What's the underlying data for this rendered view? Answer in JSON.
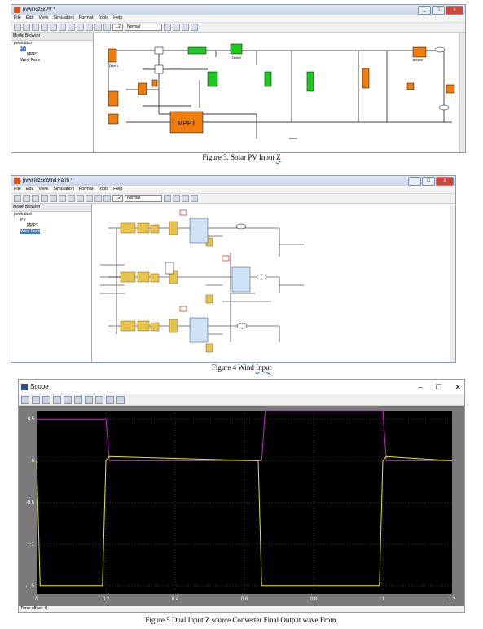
{
  "fig3": {
    "title": "pvwindzsi/PV *",
    "menu": [
      "File",
      "Edit",
      "View",
      "Simulation",
      "Format",
      "Tools",
      "Help"
    ],
    "sim_time": "1.2",
    "sim_mode": "Normal",
    "browser_title": "Model Browser",
    "tree": [
      "pvwindzsi",
      "PV",
      "MPPT",
      "Wind Farm"
    ],
    "mppt_label": "MPPT",
    "block_labels": [
      "Diode1",
      "Diode2",
      "Breaker"
    ],
    "caption": "Figure 3.  Solar PV Input ",
    "caption_z": "Z"
  },
  "fig4": {
    "title": "pvwindzsi/Wind Farm *",
    "menu": [
      "File",
      "Edit",
      "View",
      "Simulation",
      "Format",
      "Tools",
      "Help"
    ],
    "sim_time": "1.2",
    "sim_mode": "Normal",
    "browser_title": "Model Browser",
    "tree": [
      "pvwindzsi",
      "PV",
      "MPPT",
      "Wind Farm"
    ],
    "caption": "Figure 4 Wind ",
    "caption_input": "Input"
  },
  "fig5": {
    "title": "Scope",
    "time_offset_label": "Time offset:",
    "time_offset_value": "0",
    "caption": "Figure 5  Dual Input Z source Converter Final Output wave From."
  },
  "chart_data": {
    "type": "line",
    "title": "",
    "xlim": [
      0,
      1.2
    ],
    "ylim": [
      -1.6,
      0.6
    ],
    "xticks": [
      "0",
      "0.2",
      "0.4",
      "0.6",
      "0.8",
      "1",
      "1.2"
    ],
    "yticks": [
      "0.5",
      "0",
      "-0.5",
      "-1",
      "-1.5"
    ],
    "grid": true,
    "series": [
      {
        "color": "#d020d0",
        "x": [
          0,
          0.2,
          0.21,
          0.65,
          0.66,
          1.0,
          1.01,
          1.2
        ],
        "y": [
          0.5,
          0.5,
          0,
          0,
          0.6,
          0.6,
          0,
          0
        ]
      },
      {
        "color": "#e8e820",
        "x": [
          0,
          0.01,
          0.19,
          0.2,
          0.21,
          0.64,
          0.65,
          0.66,
          0.99,
          1.0,
          1.01,
          1.2
        ],
        "y": [
          0,
          -1.5,
          -1.5,
          0,
          0.05,
          0,
          -1.5,
          -1.5,
          -1.5,
          0,
          0.05,
          0
        ]
      }
    ]
  }
}
